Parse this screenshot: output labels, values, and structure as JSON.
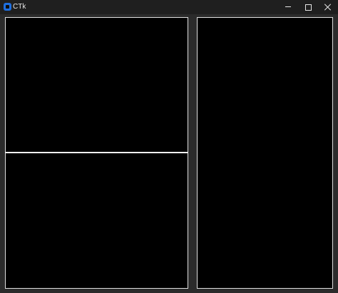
{
  "window": {
    "title": "CTk",
    "icon": "ctk-app-icon",
    "controls": {
      "minimize": "minimize-icon",
      "maximize": "maximize-icon",
      "close": "close-icon"
    }
  },
  "colors": {
    "background": "#2b2b2b",
    "titlebar": "#1f1f1f",
    "panel_fill": "#000000",
    "panel_border": "#e0e0e0",
    "accent": "#1e6fe0"
  }
}
